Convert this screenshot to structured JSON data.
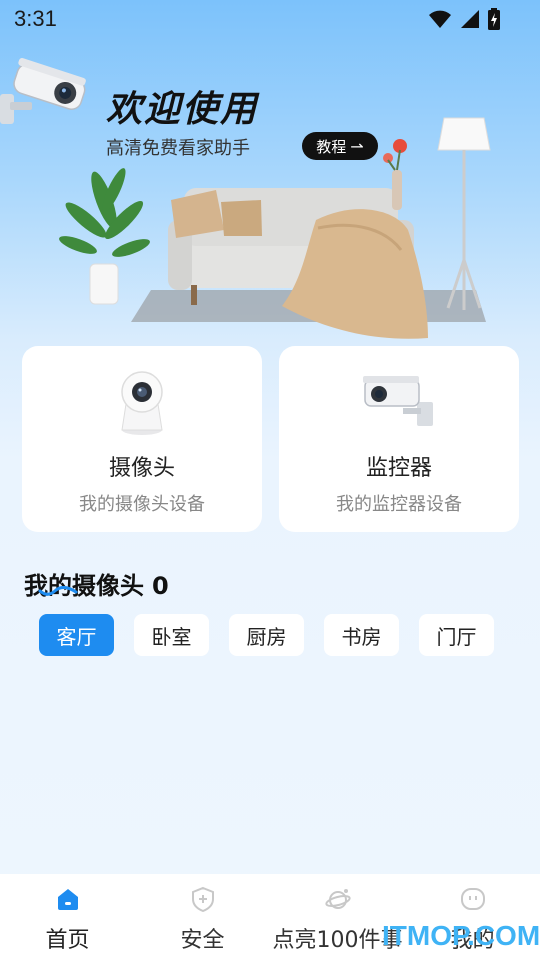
{
  "status_bar": {
    "time": "3:31"
  },
  "banner": {
    "title": "欢迎使用",
    "subtitle": "高清免费看家助手",
    "tutorial_label": "教程",
    "tutorial_arrow": "⇀"
  },
  "devices": [
    {
      "title": "摄像头",
      "subtitle": "我的摄像头设备",
      "icon": "dome-camera-icon"
    },
    {
      "title": "监控器",
      "subtitle": "我的监控器设备",
      "icon": "cctv-camera-icon"
    }
  ],
  "my_cameras": {
    "title": "我的摄像头",
    "count": "0",
    "rooms": [
      "客厅",
      "卧室",
      "厨房",
      "书房",
      "门厅"
    ],
    "active_room": "客厅"
  },
  "bottom_nav": [
    {
      "label": "首页",
      "icon": "home-icon",
      "active": true
    },
    {
      "label": "安全",
      "icon": "shield-icon",
      "active": false
    },
    {
      "label": "点亮100件事",
      "icon": "planet-icon",
      "active": false
    },
    {
      "label": "我的",
      "icon": "profile-icon",
      "active": false
    }
  ],
  "watermark": "ITMOP.COM",
  "colors": {
    "accent": "#1e8cf0",
    "banner_top": "#7cc2fb",
    "watermark": "#3fb3f5"
  }
}
